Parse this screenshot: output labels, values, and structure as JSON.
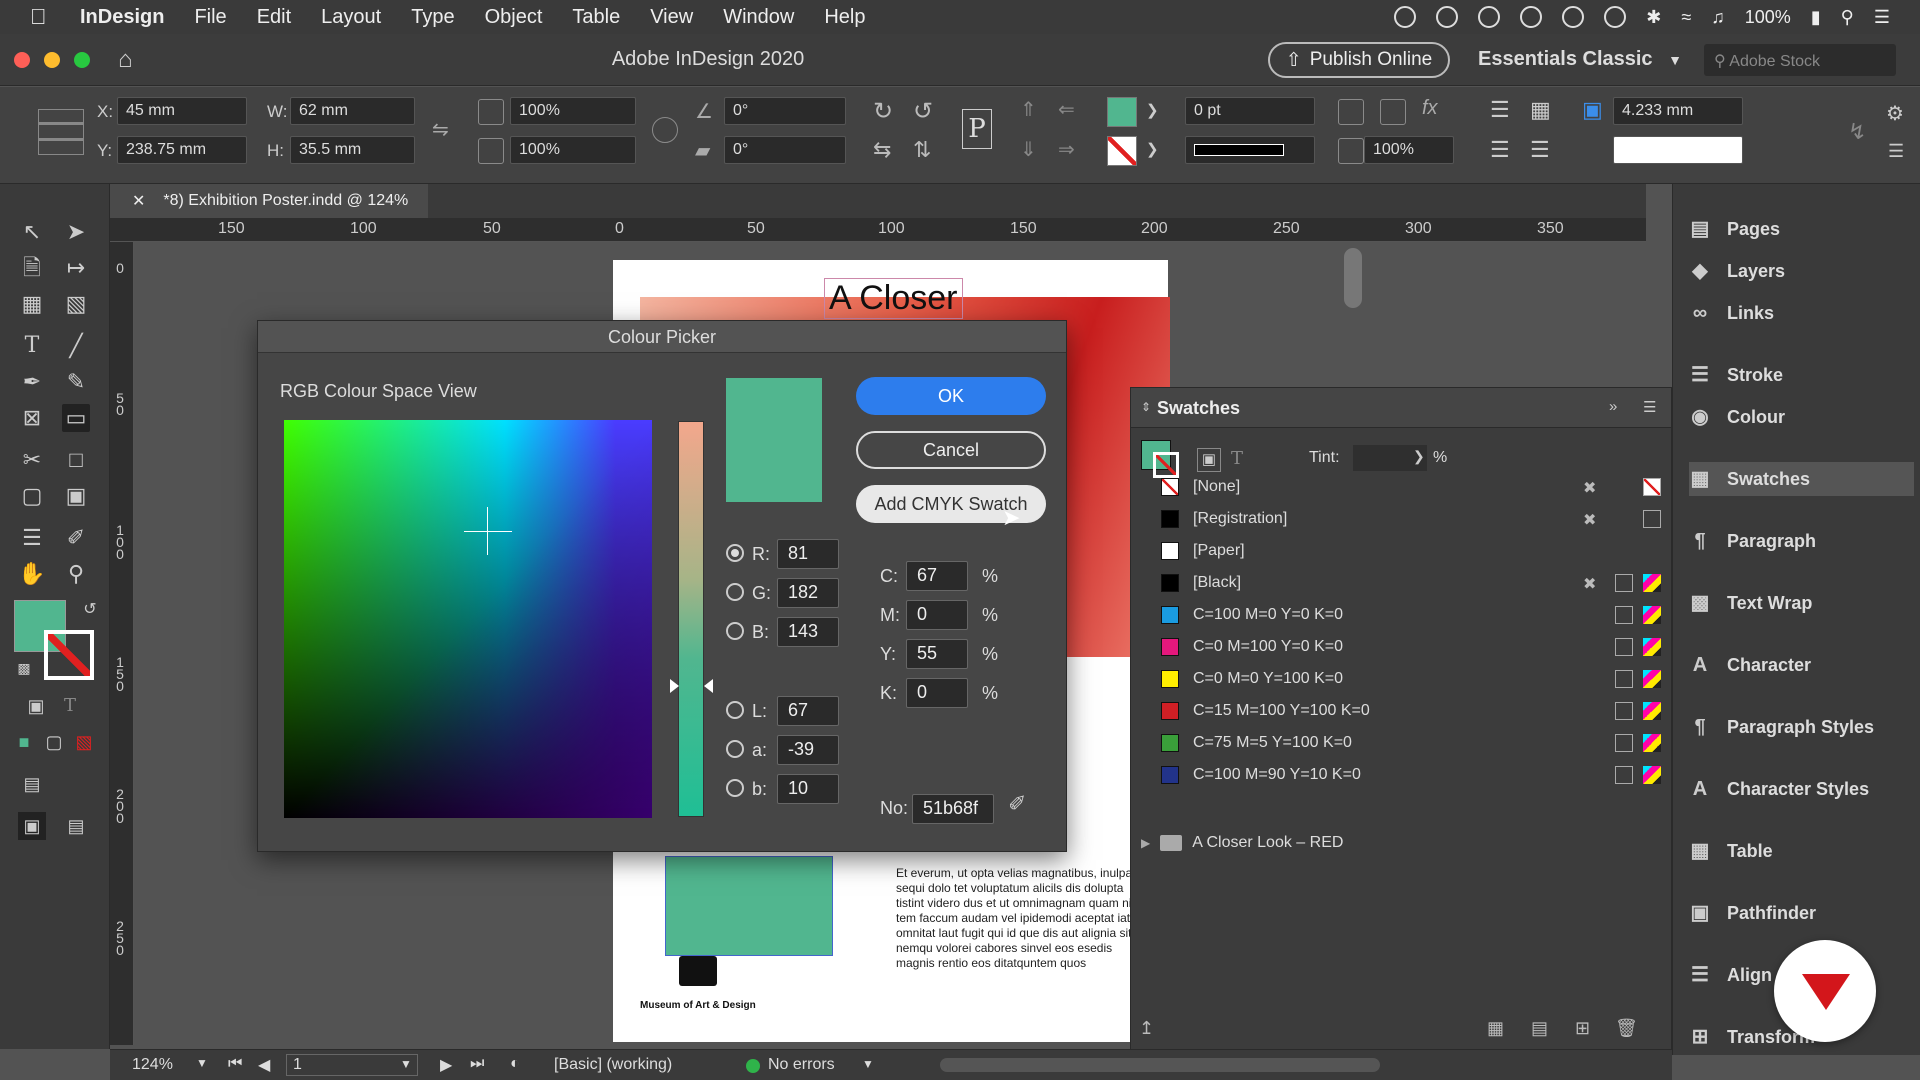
{
  "menubar": {
    "app": "InDesign",
    "items": [
      "File",
      "Edit",
      "Layout",
      "Type",
      "Object",
      "Table",
      "View",
      "Window",
      "Help"
    ],
    "battery": "100%"
  },
  "titlebar": {
    "title": "Adobe InDesign 2020",
    "publish": "Publish Online",
    "workspace": "Essentials Classic",
    "stock_placeholder": "Adobe Stock"
  },
  "control": {
    "x_label": "X:",
    "x": "45 mm",
    "y_label": "Y:",
    "y": "238.75 mm",
    "w_label": "W:",
    "w": "62 mm",
    "h_label": "H:",
    "h": "35.5 mm",
    "scale_x": "100%",
    "scale_y": "100%",
    "rotate": "0°",
    "shear": "0°",
    "stroke_weight": "0 pt",
    "opacity": "100%",
    "offset": "4.233 mm",
    "fill_color": "#51b68f"
  },
  "doc": {
    "tab": "*8) Exhibition Poster.indd @ 124%",
    "ruler_ticks": [
      "150",
      "100",
      "50",
      "0",
      "50",
      "100",
      "150",
      "200",
      "250",
      "300",
      "350"
    ],
    "vruler_ticks": [
      "0",
      "50",
      "100",
      "150",
      "200",
      "250"
    ],
    "poster_title": "A Closer",
    "body_text": "Et everum, ut opta velias magnatibus, inulpa sequi dolo tet voluptatum alicils dis dolupta tistint videro dus et ut omnimagnam quam ni tem faccum audam vel ipidemodi aceptat iatur, omnitat laut fugit qui id que dis aut alignia sitati nemqu volorei cabores sinvel eos esedis magnis rentio eos ditatquntem quos",
    "museum": "Museum of Art & Design"
  },
  "dialog": {
    "title": "Colour Picker",
    "space_label": "RGB Colour Space View",
    "ok": "OK",
    "cancel": "Cancel",
    "add_swatch": "Add CMYK Swatch",
    "r": "81",
    "g": "182",
    "b": "143",
    "l": "67",
    "a": "-39",
    "bb": "10",
    "c": "67",
    "m": "0",
    "yy": "55",
    "k": "0",
    "hex_label": "No:",
    "hex": "51b68f",
    "preview_color": "#51b68f"
  },
  "swatches": {
    "title": "Swatches",
    "tint_label": "Tint:",
    "pct": "%",
    "rows": [
      {
        "name": "[None]",
        "color": "none"
      },
      {
        "name": "[Registration]",
        "color": "#000000"
      },
      {
        "name": "[Paper]",
        "color": "#ffffff"
      },
      {
        "name": "[Black]",
        "color": "#000000"
      },
      {
        "name": "C=100 M=0 Y=0 K=0",
        "color": "#1a9be0"
      },
      {
        "name": "C=0 M=100 Y=0 K=0",
        "color": "#e4187c"
      },
      {
        "name": "C=0 M=0 Y=100 K=0",
        "color": "#ffee00"
      },
      {
        "name": "C=15 M=100 Y=100 K=0",
        "color": "#d01f25"
      },
      {
        "name": "C=75 M=5 Y=100 K=0",
        "color": "#3a9f3a"
      },
      {
        "name": "C=100 M=90 Y=10 K=0",
        "color": "#22338a"
      }
    ],
    "group": "A Closer Look – RED"
  },
  "dock": {
    "items": [
      "Pages",
      "Layers",
      "Links",
      "Stroke",
      "Colour",
      "Swatches",
      "Paragraph",
      "Text Wrap",
      "Character",
      "Paragraph Styles",
      "Character Styles",
      "Table",
      "Pathfinder",
      "Align",
      "Transform"
    ]
  },
  "status": {
    "zoom": "124%",
    "page": "1",
    "preflight_profile": "[Basic] (working)",
    "errors": "No errors"
  }
}
